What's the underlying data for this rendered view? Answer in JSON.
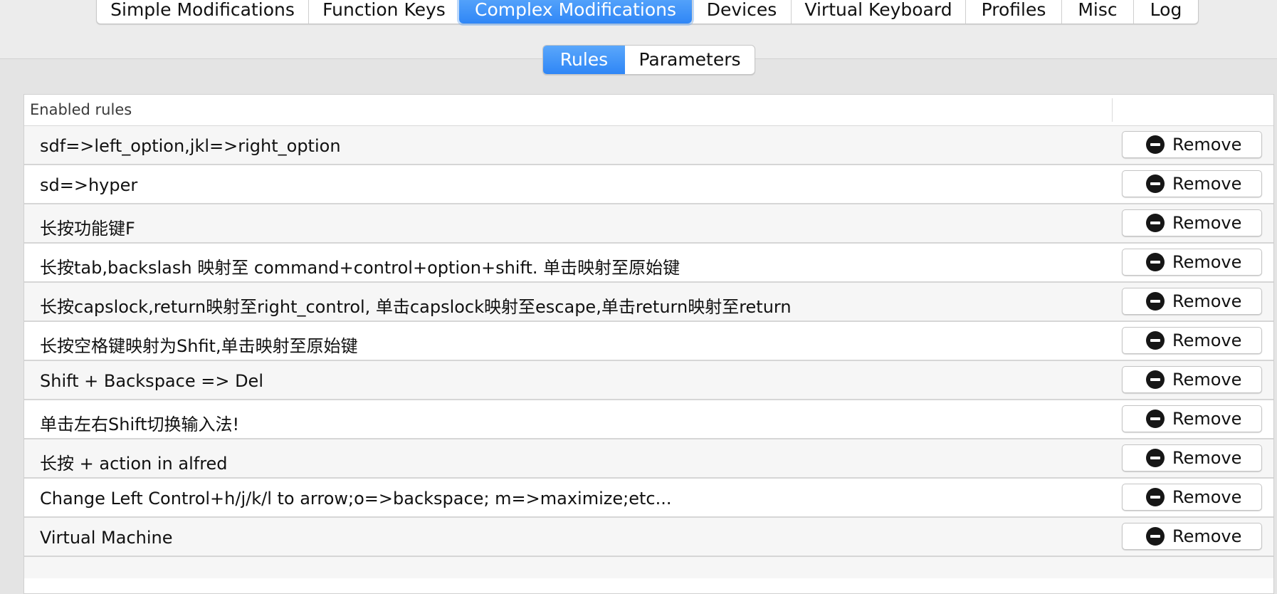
{
  "tabs": [
    {
      "label": "Simple Modifications",
      "active": false
    },
    {
      "label": "Function Keys",
      "active": false
    },
    {
      "label": "Complex Modifications",
      "active": true
    },
    {
      "label": "Devices",
      "active": false
    },
    {
      "label": "Virtual Keyboard",
      "active": false
    },
    {
      "label": "Profiles",
      "active": false
    },
    {
      "label": "Misc",
      "active": false
    },
    {
      "label": "Log",
      "active": false
    }
  ],
  "segmented": [
    {
      "label": "Rules",
      "active": true
    },
    {
      "label": "Parameters",
      "active": false
    }
  ],
  "table": {
    "header": "Enabled rules",
    "remove_label": "Remove",
    "rows": [
      "sdf=>left_option,jkl=>right_option",
      "sd=>hyper",
      "长按功能键F",
      "长按tab,backslash 映射至 command+control+option+shift. 单击映射至原始键",
      "长按capslock,return映射至right_control, 单击capslock映射至escape,单击return映射至return",
      "长按空格键映射为Shfit,单击映射至原始键",
      "Shift + Backspace => Del",
      "单击左右Shift切换输入法!",
      "长按 + action in alfred",
      "Change Left Control+h/j/k/l to arrow;o=>backspace; m=>maximize;etc...",
      "Virtual Machine"
    ]
  },
  "colors": {
    "accent": "#2f86f6",
    "accent_light": "#5aa7fb"
  },
  "icons": {
    "remove": "minus-circle-icon"
  }
}
